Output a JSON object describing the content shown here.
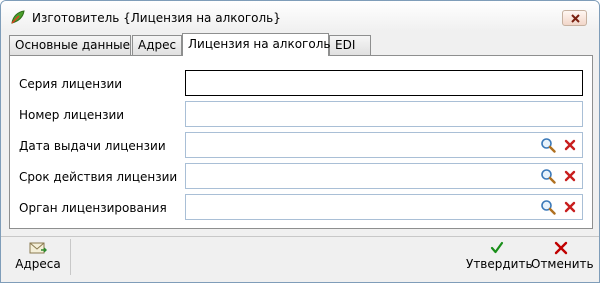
{
  "window": {
    "title": "Изготовитель {Лицензия на алкоголь}"
  },
  "tabs": [
    {
      "label": "Основные данные",
      "active": false
    },
    {
      "label": "Адрес",
      "active": false
    },
    {
      "label": "Лицензия на алкоголь",
      "active": true
    },
    {
      "label": "EDI",
      "active": false
    }
  ],
  "fields": [
    {
      "label": "Серия лицензии",
      "value": "",
      "has_lookup": false
    },
    {
      "label": "Номер лицензии",
      "value": "",
      "has_lookup": false
    },
    {
      "label": "Дата выдачи лицензии",
      "value": "",
      "has_lookup": true
    },
    {
      "label": "Срок действия лицензии",
      "value": "",
      "has_lookup": true
    },
    {
      "label": "Орган лицензирования",
      "value": "",
      "has_lookup": true
    }
  ],
  "footer": {
    "addresses_label": "Адреса",
    "confirm_label": "Утвердить",
    "cancel_label": "Отменить"
  },
  "colors": {
    "confirm": "#1a8f1a",
    "cancel": "#c00000",
    "close_x": "#b03020"
  }
}
